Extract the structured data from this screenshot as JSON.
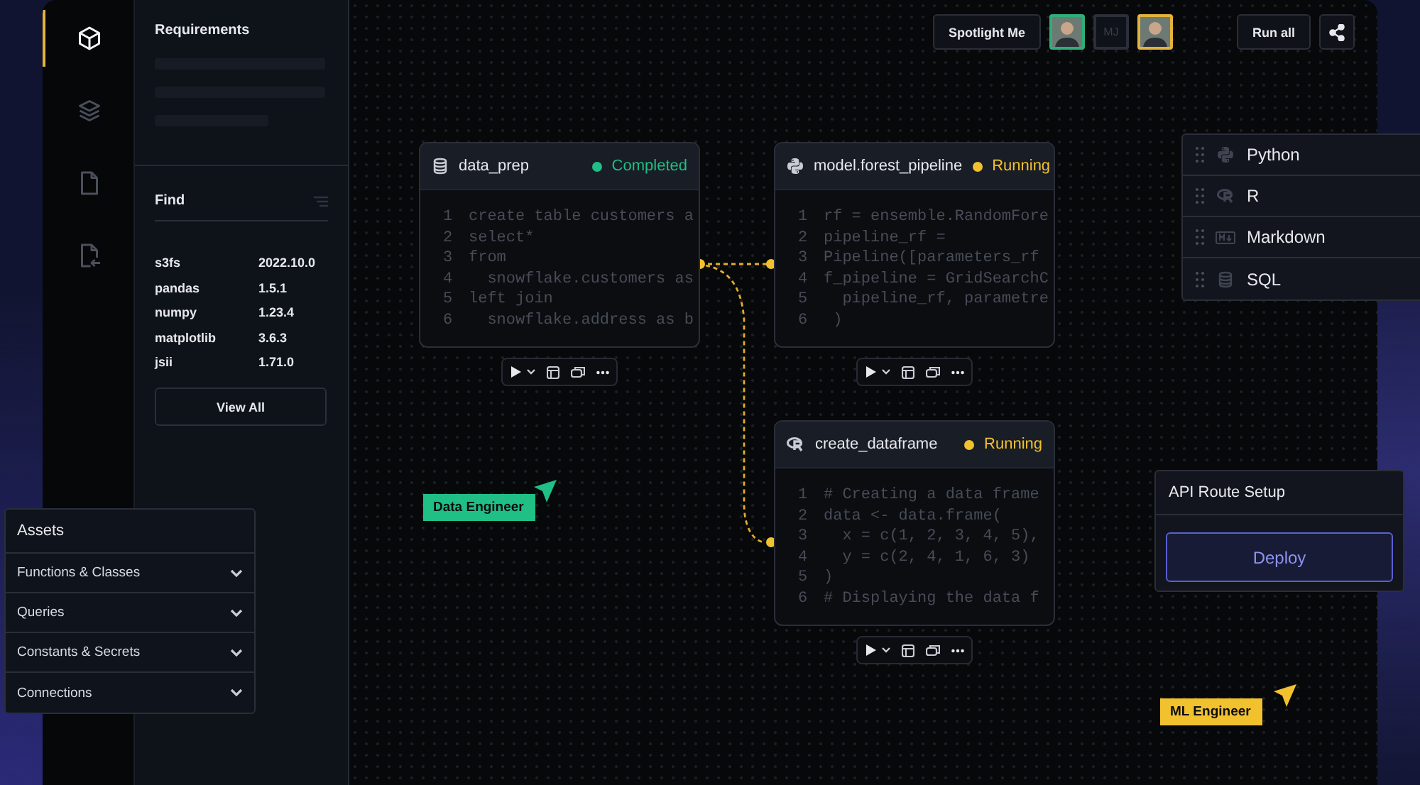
{
  "rail": {
    "items": [
      {
        "kind": "cube",
        "selected": true
      },
      {
        "kind": "layers",
        "selected": false
      },
      {
        "kind": "file",
        "selected": false
      },
      {
        "kind": "file-import",
        "selected": false
      }
    ]
  },
  "requirements": {
    "title": "Requirements"
  },
  "find": {
    "title": "Find",
    "packages": [
      {
        "name": "s3fs",
        "version": "2022.10.0"
      },
      {
        "name": "pandas",
        "version": "1.5.1"
      },
      {
        "name": "numpy",
        "version": "1.23.4"
      },
      {
        "name": "matplotlib",
        "version": "3.6.3"
      },
      {
        "name": "jsii",
        "version": "1.71.0"
      }
    ],
    "button": "View All"
  },
  "toolbar": {
    "spotlight": "Spotlight Me",
    "collaborators": [
      {
        "kind": "photo",
        "color": "#2fae7a"
      },
      {
        "kind": "initials",
        "initials": "MJ",
        "color": "#2a2f3a"
      },
      {
        "kind": "photo",
        "color": "#e2b33c"
      }
    ],
    "run_all": "Run all"
  },
  "cells": [
    {
      "title": "data_prep",
      "kind": "sql",
      "status": "Completed",
      "color": "#1fbf85",
      "lines": [
        {
          "number": "1",
          "code": "create table customers a"
        },
        {
          "number": "2",
          "code": "select*"
        },
        {
          "number": "3",
          "code": "from"
        },
        {
          "number": "4",
          "code": "  snowflake.customers as"
        },
        {
          "number": "5",
          "code": "left join"
        },
        {
          "number": "6",
          "code": "  snowflake.address as b"
        }
      ]
    },
    {
      "title": "model.forest_pipeline",
      "kind": "python",
      "status": "Running",
      "color": "#f2c12e",
      "lines": [
        {
          "number": "1",
          "code": "rf = ensemble.RandomFore"
        },
        {
          "number": "2",
          "code": "pipeline_rf ="
        },
        {
          "number": "3",
          "code": "Pipeline([parameters_rf"
        },
        {
          "number": "4",
          "code": "f_pipeline = GridSearchC"
        },
        {
          "number": "5",
          "code": "  pipeline_rf, parametre"
        },
        {
          "number": "6",
          "code": " )"
        }
      ]
    },
    {
      "title": "create_dataframe",
      "kind": "r",
      "status": "Running",
      "color": "#f2c12e",
      "lines": [
        {
          "number": "1",
          "code": "# Creating a data frame"
        },
        {
          "number": "2",
          "code": "data <- data.frame("
        },
        {
          "number": "3",
          "code": "  x = c(1, 2, 3, 4, 5),"
        },
        {
          "number": "4",
          "code": "  y = c(2, 4, 1, 6, 3)"
        },
        {
          "number": "5",
          "code": ")"
        },
        {
          "number": "6",
          "code": "# Displaying the data f"
        }
      ]
    }
  ],
  "languages": [
    {
      "name": "Python",
      "kind": "python"
    },
    {
      "name": "R",
      "kind": "r"
    },
    {
      "name": "Markdown",
      "kind": "markdown"
    },
    {
      "name": "SQL",
      "kind": "sql"
    }
  ],
  "assets": {
    "title": "Assets",
    "sections": [
      {
        "label": "Functions & Classes",
        "expanded": false
      },
      {
        "label": "Queries",
        "expanded": false
      },
      {
        "label": "Constants & Secrets",
        "expanded": false
      },
      {
        "label": "Connections",
        "expanded": false
      }
    ]
  },
  "api_panel": {
    "title": "API Route Setup",
    "button": "Deploy"
  },
  "cursors": [
    {
      "label": "Data Engineer",
      "color": "#1fbf85"
    },
    {
      "label": "ML Engineer",
      "color": "#f2c12e"
    }
  ]
}
